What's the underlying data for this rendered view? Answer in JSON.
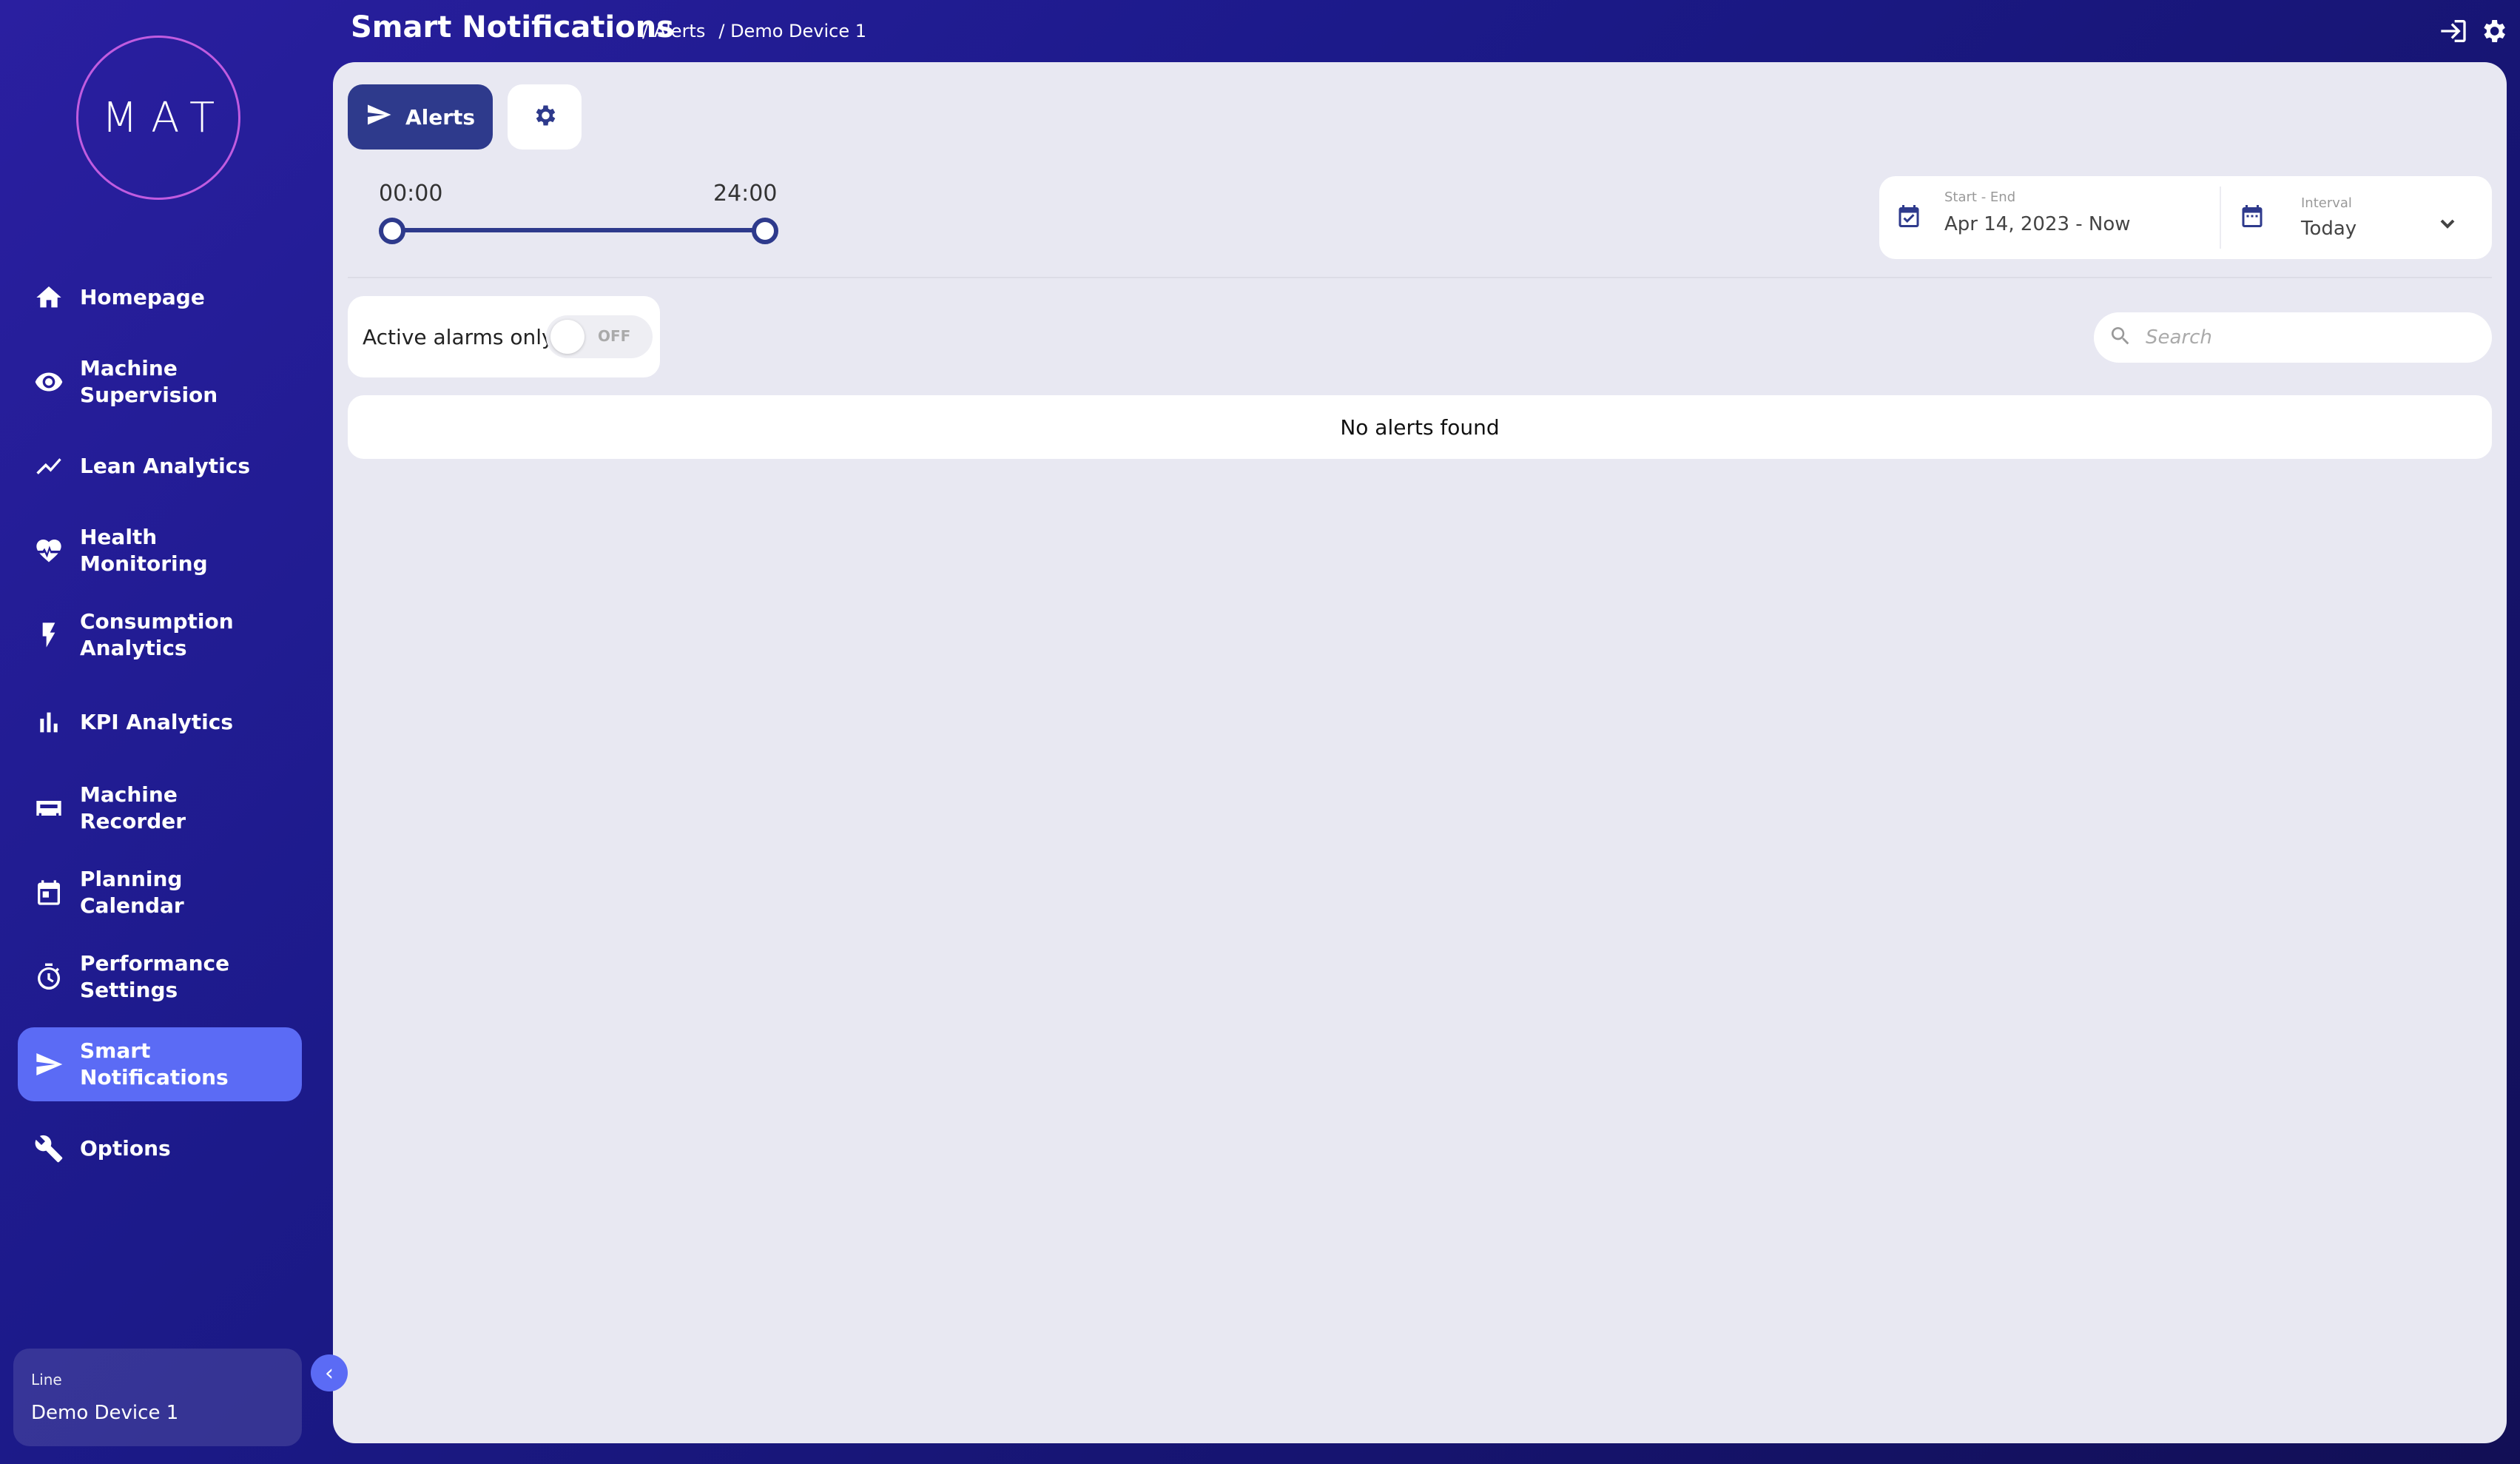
{
  "app": {
    "logo_text": "MAT",
    "page_title": "Smart Notifications",
    "breadcrumb": [
      "/ Alerts",
      "/ Demo Device 1"
    ]
  },
  "colors": {
    "sidebar_bg": "#1c1a8a",
    "active_nav": "#5b6bf5",
    "accent": "#2e3a8c",
    "panel_bg": "#e8e8f2"
  },
  "sidebar": {
    "items": [
      {
        "label": "Homepage",
        "icon": "home-icon"
      },
      {
        "label": "Machine Supervision",
        "icon": "eye-icon"
      },
      {
        "label": "Lean Analytics",
        "icon": "trend-line-icon"
      },
      {
        "label": "Health Monitoring",
        "icon": "heart-pulse-icon"
      },
      {
        "label": "Consumption Analytics",
        "icon": "lightning-icon"
      },
      {
        "label": "KPI Analytics",
        "icon": "bar-chart-icon"
      },
      {
        "label": "Machine Recorder",
        "icon": "recorder-icon"
      },
      {
        "label": "Planning Calendar",
        "icon": "calendar-icon"
      },
      {
        "label": "Performance Settings",
        "icon": "stopwatch-icon"
      },
      {
        "label": "Smart Notifications",
        "icon": "send-icon",
        "active": true
      },
      {
        "label": "Options",
        "icon": "wrench-icon"
      }
    ],
    "line": {
      "label": "Line",
      "value": "Demo Device 1"
    }
  },
  "toolbar": {
    "alerts_label": "Alerts"
  },
  "time_range": {
    "start": "00:00",
    "end": "24:00"
  },
  "date_picker": {
    "range_sublabel": "Start - End",
    "range_value": "Apr 14, 2023 - Now",
    "interval_sublabel": "Interval",
    "interval_value": "Today"
  },
  "filters": {
    "active_only_label": "Active alarms only",
    "toggle_state": "OFF",
    "search_placeholder": "Search"
  },
  "alerts": {
    "empty_message": "No alerts found"
  }
}
